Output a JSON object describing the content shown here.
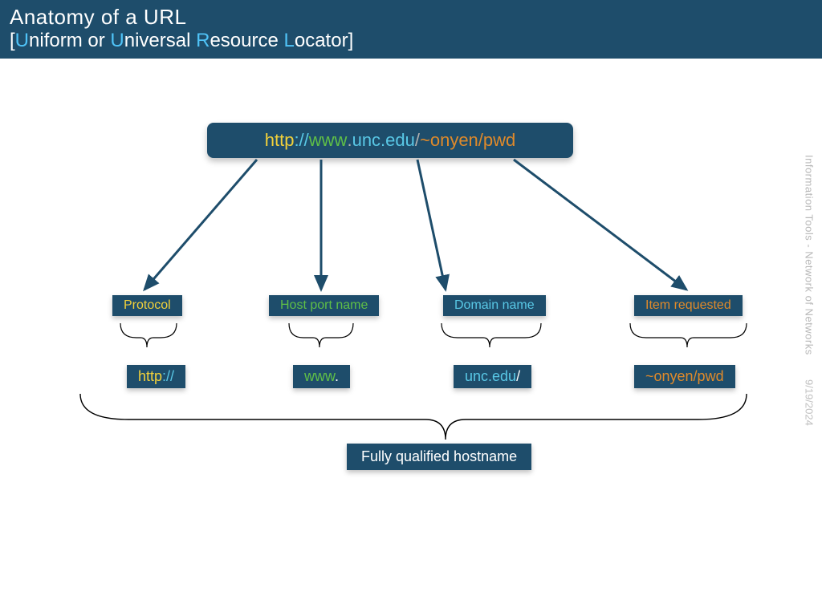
{
  "header": {
    "title": "Anatomy of a URL",
    "subtitle_open": "[",
    "u1": "U",
    "rest1": "niform  or ",
    "u2": "U",
    "rest2": "niversal ",
    "u3": "R",
    "rest3": "esource ",
    "u4": "L",
    "rest4": "ocator",
    "subtitle_close": "]"
  },
  "url": {
    "p_http": "http",
    "p_sep": "://",
    "p_www": "www",
    "p_dot1": ".",
    "p_unc": "unc.edu",
    "p_slash": "/",
    "p_path": "~onyen/pwd"
  },
  "labels": {
    "protocol": "Protocol",
    "host": "Host port name",
    "domain": "Domain name",
    "item": "Item requested",
    "full": "Fully qualified hostname"
  },
  "values": {
    "proto_http": "http",
    "proto_sep": "://",
    "host_www": "www",
    "host_dot": ".",
    "dom_unc": "unc.edu",
    "dom_slash": "/",
    "item_path": "~onyen/pwd"
  },
  "sidebar": {
    "title": "Information Tools - Network of Networks",
    "date": "9/19/2024"
  }
}
